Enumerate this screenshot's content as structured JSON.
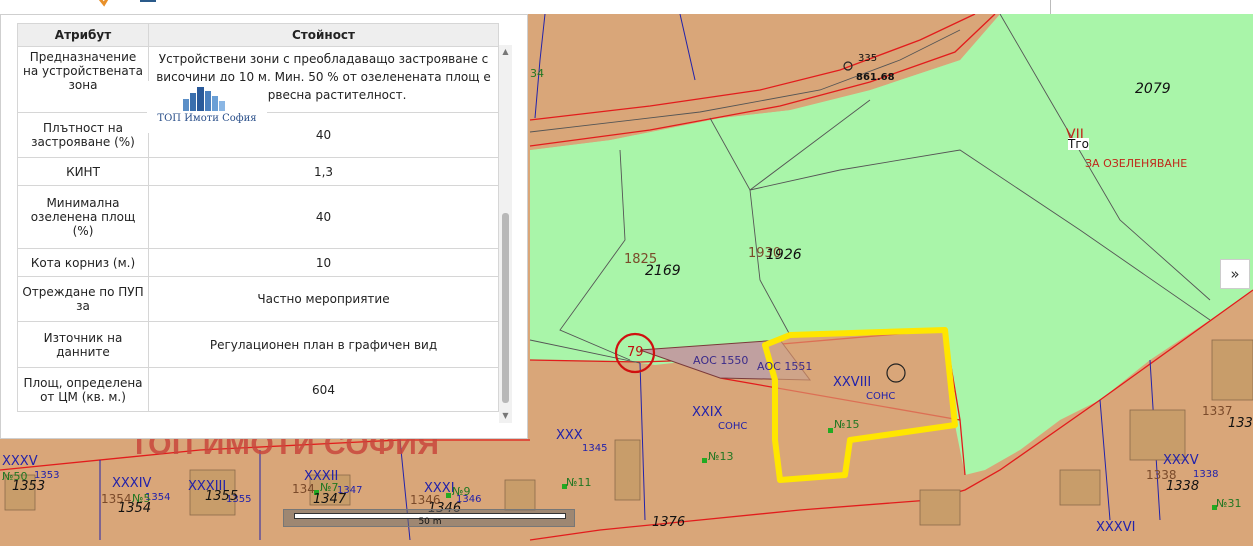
{
  "panel": {
    "header_attr": "Атрибут",
    "header_value": "Стойност",
    "rows": [
      {
        "attr": "Предназначение на устройствената зона",
        "value": "Устройствени зони с преобладаващо застрояване с височини до 10 м. Мин. 50 % от озеленената площ е с дървесна растителност."
      },
      {
        "attr": "Плътност на застрояване (%)",
        "value": "40"
      },
      {
        "attr": "КИНТ",
        "value": "1,3"
      },
      {
        "attr": "Минимална озеленена площ (%)",
        "value": "40"
      },
      {
        "attr": "Кота корниз (м.)",
        "value": "10"
      },
      {
        "attr": "Отреждане по ПУП за",
        "value": "Частно мероприятие"
      },
      {
        "attr": "Източник на данните",
        "value": "Регулационен план в графичен вид"
      },
      {
        "attr": "Площ, определена от ЦМ (кв. м.)",
        "value": "604"
      }
    ]
  },
  "watermark": {
    "logo_text": "ТОП Имоти София",
    "big_text": "ТОП ИМОТИ СОФИЯ"
  },
  "map": {
    "labels": {
      "p2079": "2079",
      "p2169": "2169",
      "p1825": "1825",
      "p1926": "1926",
      "p1930": "1930",
      "p335": "335",
      "p861": "861.68",
      "p34": "34",
      "vii": "VII",
      "tro": "Тго",
      "za_ozel": "ЗА ОЗЕЛЕНЯВАНЕ",
      "p79": "79",
      "aoc1550": "АОС 1550",
      "aoc1551": "АОС 1551",
      "xxviii": "XXVIII",
      "sons1": "СОНС",
      "xxix": "XXIX",
      "sons2": "СОНС",
      "n15": "№15",
      "n13": "№13",
      "xxx": "XXX",
      "p1345": "1345",
      "n11": "№11",
      "xxxi": "XXXI",
      "p1346a": "1346",
      "p1346b": "1346",
      "p1346c": "1346",
      "n9": "№9",
      "xxxii": "XXXII",
      "p1347a": "1347",
      "p1347b": "1347",
      "p1347c": "134",
      "n7": "№7",
      "xxxiii": "XXXIII",
      "p1355a": "1355",
      "p1355b": "1355",
      "xxxiv": "XXXIV",
      "p1354a": "1354",
      "p1354b": "1354",
      "p1354c": "1354",
      "n5": "№5",
      "xxxv": "XXXV",
      "p1353a": "1353",
      "p1353b": "1353",
      "p1376": "1376",
      "xxxv2": "XXXV",
      "p1338a": "1338",
      "p1338b": "1338",
      "p1338c": "1338",
      "p1337a": "1337",
      "p1337b": "1337",
      "xxxvi": "XXXVI",
      "n31": "№31",
      "n50": "№50"
    },
    "scale_text": "50 m"
  },
  "nav": {
    "next_label": "»"
  },
  "colors": {
    "green_zone": "#a9f5a9",
    "brown_zone": "#d9a679",
    "red_line": "#e21c1c",
    "highlight": "#ffe600",
    "blue_line": "#2222aa"
  }
}
